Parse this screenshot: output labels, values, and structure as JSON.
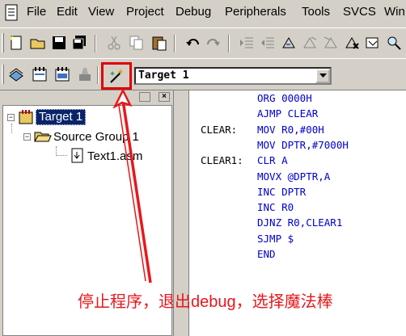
{
  "menu": {
    "items": [
      {
        "label": "File",
        "hot": "F"
      },
      {
        "label": "Edit",
        "hot": "E"
      },
      {
        "label": "View",
        "hot": "V"
      },
      {
        "label": "Project",
        "hot": "P"
      },
      {
        "label": "Debug",
        "hot": "D"
      },
      {
        "label": "Peripherals",
        "hot": "r"
      },
      {
        "label": "Tools",
        "hot": "T"
      },
      {
        "label": "SVCS",
        "hot": "S"
      },
      {
        "label": "Win",
        "hot": "W"
      }
    ]
  },
  "toolbar2": {
    "target_select": "Target 1"
  },
  "project": {
    "root": "Target 1",
    "group": "Source Group 1",
    "file": "Text1.asm"
  },
  "code": {
    "lines": [
      {
        "label": "",
        "text": "ORG 0000H"
      },
      {
        "label": "",
        "text": "AJMP CLEAR"
      },
      {
        "label": "CLEAR:",
        "text": "MOV R0,#00H"
      },
      {
        "label": "",
        "text": "MOV DPTR,#7000H"
      },
      {
        "label": "CLEAR1:",
        "text": "CLR A"
      },
      {
        "label": "",
        "text": "MOVX @DPTR,A"
      },
      {
        "label": "",
        "text": "INC DPTR"
      },
      {
        "label": "",
        "text": "INC R0"
      },
      {
        "label": "",
        "text": "DJNZ R0,CLEAR1"
      },
      {
        "label": "",
        "text": "SJMP $"
      },
      {
        "label": "",
        "text": "END"
      }
    ]
  },
  "annotation": {
    "text": "停止程序，退出debug，选择魔法棒",
    "color": "#e8171b"
  },
  "colors": {
    "selection": "#0a246a",
    "chrome": "#d4d0c8",
    "code_keyword": "#0000cc"
  }
}
